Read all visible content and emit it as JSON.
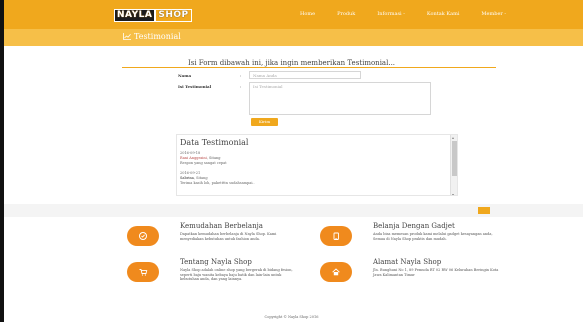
{
  "logo": {
    "word1": "NAYLA",
    "word2": "SHOP"
  },
  "nav": {
    "items": [
      {
        "label": "Home"
      },
      {
        "label": "Produk"
      },
      {
        "label": "Informasi -"
      },
      {
        "label": "Kontak Kami"
      },
      {
        "label": "Member -"
      }
    ]
  },
  "header": {
    "title": "Testimonial",
    "icon": "chart-icon"
  },
  "form": {
    "heading": "Isi Form dibawah ini, jika ingin memberikan Testimonial...",
    "name_label": "Nama",
    "name_colon": ":",
    "name_placeholder": "Nama Anda",
    "testimonial_label": "Isi Testimonial",
    "testimonial_colon": ":",
    "testimonial_placeholder": "Isi Testimonial",
    "submit_label": "Kirim"
  },
  "testimonials": {
    "title": "Data Testimonial",
    "entries": [
      {
        "date": "2016-09-18",
        "name": "Rani Anggraini",
        "city": ", Sitang",
        "text": "Respon yang sangat cepat"
      },
      {
        "date": "2016-09-21",
        "name": "Sabrina",
        "city": ", Sitang",
        "text": "Terima kasih loh, pakettttn sudahsampai.."
      }
    ]
  },
  "features": [
    {
      "title": "Kemudahan Berbelanja",
      "icon": "check-circle-icon",
      "desc": "Dapatkan kemudahan berbelanja di Nayla Shop. Kami menyediakan kebutuhan untuk fashion anda."
    },
    {
      "title": "Belanja Dengan Gadjet",
      "icon": "tablet-icon",
      "desc": "Anda bisa memesan produk kami melalui gadget kesayangan anda, Semua di Nayla Shop praktis dan mudah."
    },
    {
      "title": "Tentang Nayla Shop",
      "icon": "cart-icon",
      "desc": "Nayla Shop adalah online shop yang bergerak di bidang fesion, seperti baju wanita kebaya baju batik dan lain-lain untuk kebutuhan anda, dan yang lainnya."
    },
    {
      "title": "Alamat Nayla Shop",
      "icon": "home-icon",
      "desc": "Jln. Bunghuni No 1, 89 Pemuda RT 02 RW 06 Kelurahan Beringin Kota Jawa Kalimantan Timur"
    }
  ],
  "footer": {
    "copyright": "Copyright © Nayla Shop 2016"
  },
  "colors": {
    "brand": "#f0a81d",
    "brand_light": "#f6bf48",
    "accent": "#f08a1d"
  }
}
